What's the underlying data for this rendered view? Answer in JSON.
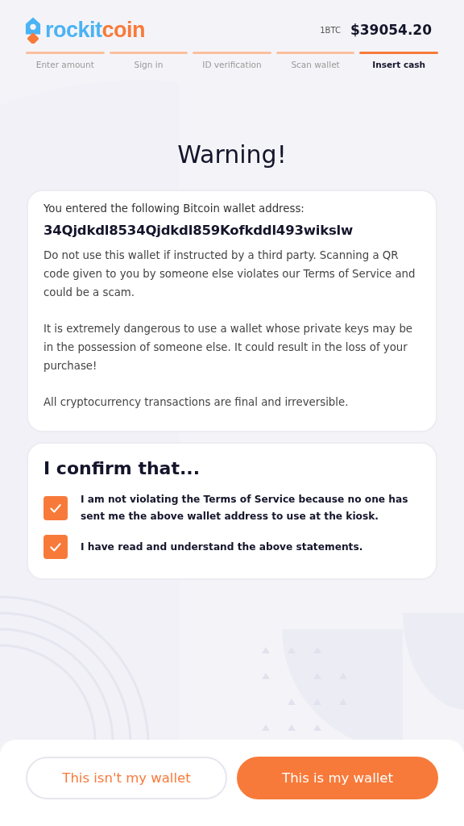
{
  "header": {
    "logo": {
      "part_1": "rockit",
      "part_2": "coin"
    },
    "rate_unit": "1BTC",
    "rate_value": "$39054.20"
  },
  "steps": [
    {
      "label": "Enter amount",
      "selected": false
    },
    {
      "label": "Sign in",
      "selected": false
    },
    {
      "label": "ID verification",
      "selected": false
    },
    {
      "label": "Scan wallet",
      "selected": false
    },
    {
      "label": "Insert cash",
      "selected": true
    }
  ],
  "title": "Warning!",
  "warning_card": {
    "intro": "You entered the following Bitcoin wallet address:",
    "address": "34Qjdkdl8534Qjdkdl859Kofkddl493wikslw",
    "paragraphs": [
      "Do not use this wallet if instructed by a third party. Scanning a QR code given to you by someone else violates our Terms of Service and could be a scam.",
      "It is extremely dangerous to use a wallet whose private keys may be in the possession of someone else. It could result in the loss of your purchase!",
      "All cryptocurrency transactions are final and irreversible."
    ]
  },
  "confirm_card": {
    "title": "I confirm that...",
    "items": [
      {
        "label": "I am not violating the Terms of Service because no one has sent me the above wallet address to use at the kiosk.",
        "checked": true
      },
      {
        "label": "I have read and understand the above statements.",
        "checked": true
      }
    ]
  },
  "buttons": [
    {
      "label": "This isn't my wallet",
      "kind": "secondary"
    },
    {
      "label": "This is my wallet",
      "kind": "primary"
    }
  ]
}
